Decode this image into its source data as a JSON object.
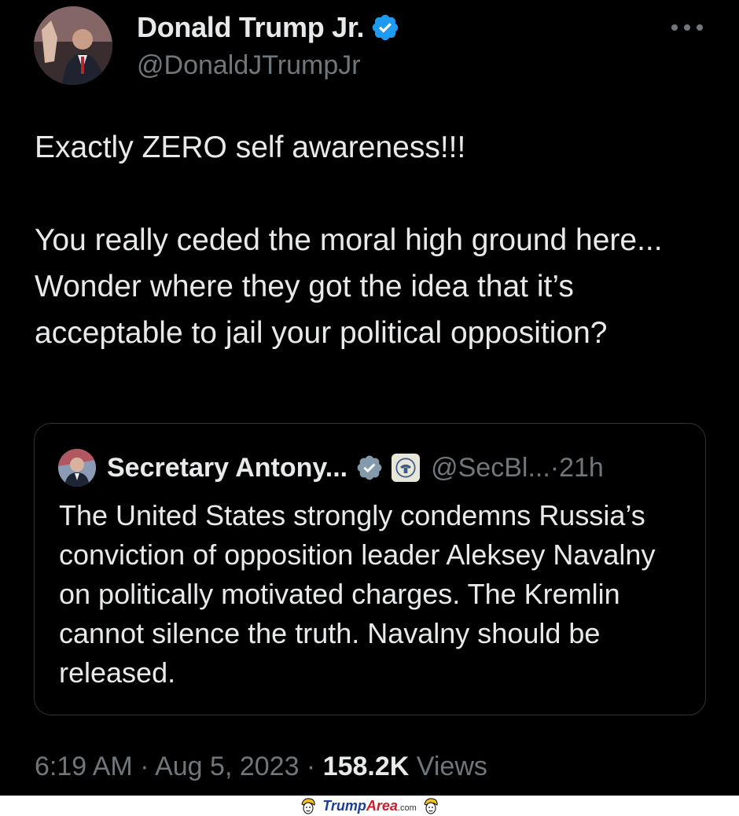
{
  "tweet": {
    "display_name": "Donald Trump Jr.",
    "handle": "@DonaldJTrumpJr",
    "text": "Exactly ZERO self awareness!!!\n\nYou really ceded the moral high ground here... Wonder where they got the idea that it’s acceptable to jail your political opposition?",
    "verified_icon": "verified-badge-icon",
    "more_icon": "more-options-icon"
  },
  "quote": {
    "display_name": "Secretary Antony...",
    "handle": "@SecBl...",
    "separator": " · ",
    "time": "21h",
    "text": "The United States strongly condemns Russia’s conviction of opposition leader Aleksey Navalny on politically motivated charges. The Kremlin cannot silence the truth. Navalny should be released."
  },
  "meta": {
    "time": "6:19 AM",
    "separator": " · ",
    "date": "Aug 5, 2023",
    "views_count": "158.2K",
    "views_label": "Views"
  },
  "watermark": {
    "brand_part1": "Trump",
    "brand_part2": "Area",
    "brand_suffix": ".com"
  },
  "colors": {
    "background": "#000000",
    "text": "#e7e9ea",
    "muted": "#71767b",
    "verified": "#1d9bf0",
    "border": "#2f3336"
  }
}
